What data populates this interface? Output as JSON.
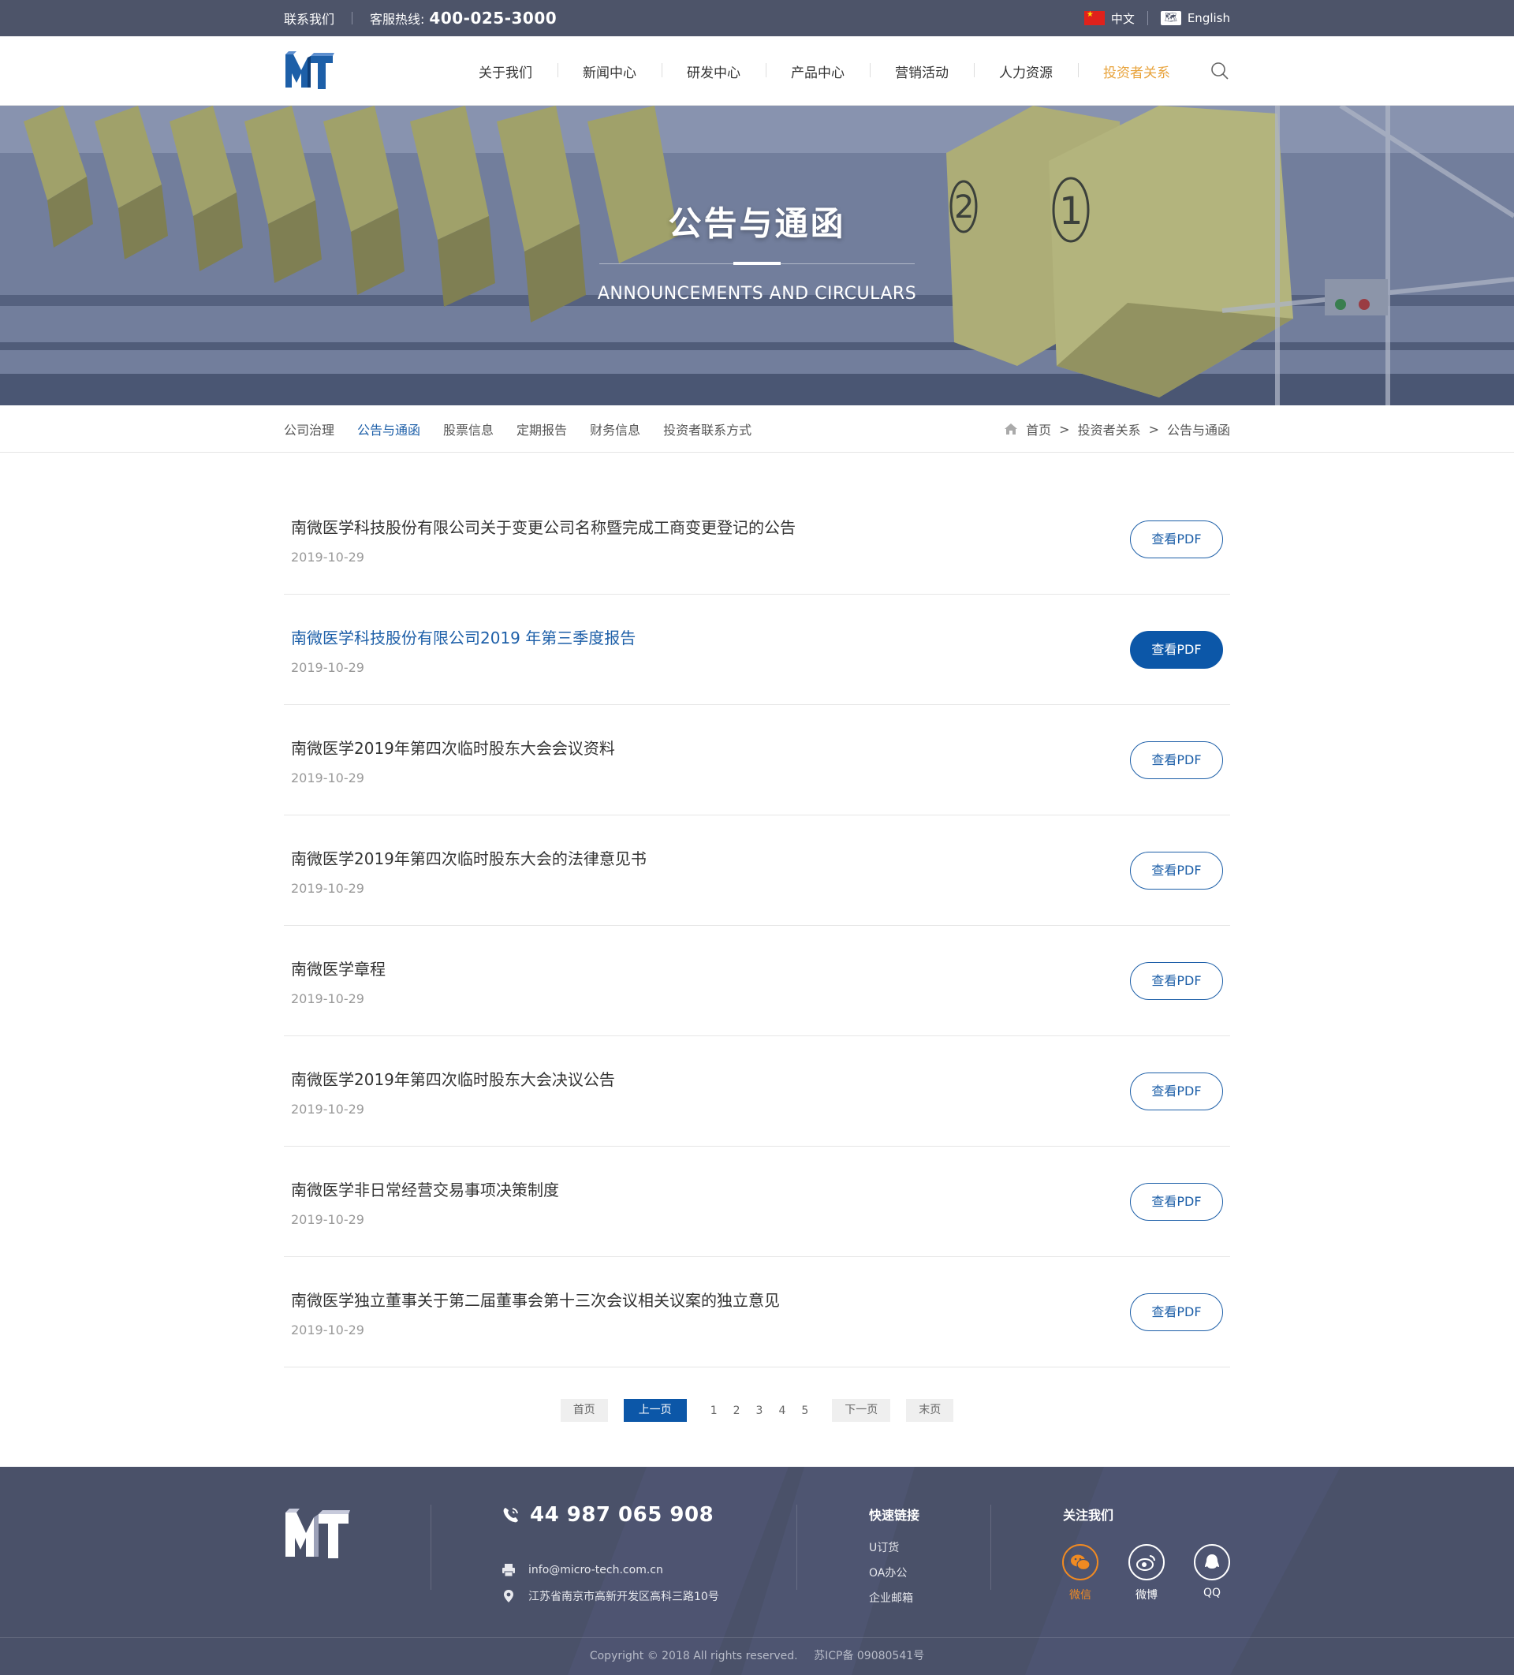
{
  "topbar": {
    "contact": "联系我们",
    "hotline_label": "客服热线:",
    "hotline_number": "400-025-3000",
    "lang_cn": "中文",
    "lang_en": "English"
  },
  "nav": {
    "items": [
      "关于我们",
      "新闻中心",
      "研发中心",
      "产品中心",
      "营销活动",
      "人力资源",
      "投资者关系"
    ],
    "active_index": 6
  },
  "banner": {
    "title": "公告与通函",
    "subtitle": "ANNOUNCEMENTS AND CIRCULARS"
  },
  "subnav": {
    "tabs": [
      "公司治理",
      "公告与通函",
      "股票信息",
      "定期报告",
      "财务信息",
      "投资者联系方式"
    ],
    "active_index": 1
  },
  "breadcrumb": {
    "home": "首页",
    "sep": ">",
    "level1": "投资者关系",
    "level2": "公告与通函"
  },
  "announcements": [
    {
      "title": "南微医学科技股份有限公司关于变更公司名称暨完成工商变更登记的公告",
      "date": "2019-10-29",
      "button": "查看PDF"
    },
    {
      "title": "南微医学科技股份有限公司2019 年第三季度报告",
      "date": "2019-10-29",
      "button": "查看PDF"
    },
    {
      "title": "南微医学2019年第四次临时股东大会会议资料",
      "date": "2019-10-29",
      "button": "查看PDF"
    },
    {
      "title": "南微医学2019年第四次临时股东大会的法律意见书",
      "date": "2019-10-29",
      "button": "查看PDF"
    },
    {
      "title": "南微医学章程",
      "date": "2019-10-29",
      "button": "查看PDF"
    },
    {
      "title": "南微医学2019年第四次临时股东大会决议公告",
      "date": "2019-10-29",
      "button": "查看PDF"
    },
    {
      "title": "南微医学非日常经营交易事项决策制度",
      "date": "2019-10-29",
      "button": "查看PDF"
    },
    {
      "title": "南微医学独立董事关于第二届董事会第十三次会议相关议案的独立意见",
      "date": "2019-10-29",
      "button": "查看PDF"
    }
  ],
  "pagination": {
    "first": "首页",
    "prev": "上一页",
    "pages": [
      "1",
      "2",
      "3",
      "4",
      "5"
    ],
    "next": "下一页",
    "last": "末页"
  },
  "footer": {
    "phone": "44 987 065 908",
    "email": "info@micro-tech.com.cn",
    "address": "江苏省南京市高新开发区高科三路10号",
    "quick_links_title": "快速链接",
    "quick_links": [
      "U订货",
      "OA办公",
      "企业邮箱"
    ],
    "follow_title": "关注我们",
    "social": [
      "微信",
      "微博",
      "QQ"
    ],
    "copyright": "Copyright © 2018 All rights reserved.",
    "icp": "苏ICP备 09080541号"
  },
  "colors": {
    "topbar_bg": "#4d5469",
    "brand_blue": "#1d5fa8",
    "button_blue": "#0c57a8",
    "nav_active": "#e8a33c",
    "footer_bg": "#4a5169",
    "wechat_orange": "#f08a22"
  },
  "icons": [
    "china-flag-icon",
    "globe-icon",
    "search-icon",
    "home-icon",
    "phone-icon",
    "printer-icon",
    "location-pin-icon",
    "wechat-icon",
    "weibo-icon",
    "qq-icon"
  ]
}
